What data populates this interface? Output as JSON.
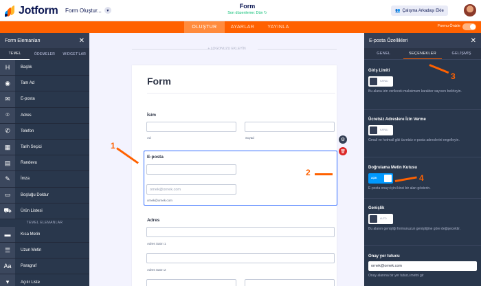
{
  "brand": {
    "name": "Jotform",
    "colors": {
      "orange": "#ff6100",
      "navy": "#0a1551",
      "panel": "#29374c",
      "blue": "#2e69ff"
    }
  },
  "topbar": {
    "form_name": "Form Oluştur...",
    "title": "Form",
    "status": "Son düzenleme: Dün",
    "team_button": "Çalışma Arkadaşı Ekle"
  },
  "nav": {
    "tabs": [
      "OLUŞTUR",
      "AYARLAR",
      "YAYINLA"
    ],
    "active": "OLUŞTUR",
    "preview_label": "Formu Önizle"
  },
  "left_panel": {
    "title": "Form Elemanları",
    "tabs": [
      "TEMEL",
      "ÖDEMELER",
      "WIDGET'LAR"
    ],
    "items": [
      {
        "icon": "heading-icon",
        "glyph": "H",
        "label": "Başlık"
      },
      {
        "icon": "user-icon",
        "glyph": "◉",
        "label": "Tam Ad"
      },
      {
        "icon": "mail-icon",
        "glyph": "✉",
        "label": "E-posta"
      },
      {
        "icon": "location-icon",
        "glyph": "⌾",
        "label": "Adres"
      },
      {
        "icon": "phone-icon",
        "glyph": "✆",
        "label": "Telefon"
      },
      {
        "icon": "calendar-icon",
        "glyph": "▦",
        "label": "Tarih Seçici"
      },
      {
        "icon": "appointment-icon",
        "glyph": "▤",
        "label": "Randevu"
      },
      {
        "icon": "signature-icon",
        "glyph": "✎",
        "label": "İmza"
      },
      {
        "icon": "fill-blank-icon",
        "glyph": "▭",
        "label": "Boşluğu Doldur"
      },
      {
        "icon": "cart-icon",
        "glyph": "⛟",
        "label": "Ürün Listesi"
      }
    ],
    "section_label": "TEMEL ELEMANLAR",
    "items2": [
      {
        "icon": "short-text-icon",
        "glyph": "▬",
        "label": "Kısa Metin"
      },
      {
        "icon": "long-text-icon",
        "glyph": "☰",
        "label": "Uzun Metin"
      },
      {
        "icon": "paragraph-icon",
        "glyph": "Aa",
        "label": "Paragraf"
      },
      {
        "icon": "dropdown-icon",
        "glyph": "▾",
        "label": "Açılır Liste"
      }
    ]
  },
  "canvas": {
    "logo_hint": "+ LOGONUZU EKLEYİN",
    "form_title": "Form",
    "name_label": "İsim",
    "first_sub": "Ad",
    "last_sub": "Soyad",
    "email_label": "E-posta",
    "email_placeholder": "ornek@ornek.com",
    "email_sub": "ornek@ornek.com",
    "address_label": "Adres",
    "addr1_sub": "Adres Satırı 1",
    "addr2_sub": "Adres Satırı 2"
  },
  "right_panel": {
    "title": "E-posta Özellikleri",
    "tabs": [
      "GENEL",
      "SEÇENEKLER",
      "GELİŞMİŞ"
    ],
    "active_tab": "SEÇENEKLER",
    "sections": {
      "limit": {
        "title": "Giriş Limiti",
        "toggle": "KAPALI",
        "desc": "Bu alana izin verilecek maksimum karakter sayısını belirleyin."
      },
      "free": {
        "title": "Ücretsiz Adreslere İzin Verme",
        "toggle": "KAPALI",
        "desc": "Gmail ve hotmail gibi ücretsiz e-posta adreslerini engelleyin."
      },
      "confirm": {
        "title": "Doğrulama Metin Kutusu",
        "toggle": "AÇIK",
        "desc": "E-posta onayı için ikinci bir alan gösterin."
      },
      "width": {
        "title": "Genişlik",
        "toggle": "AUTO",
        "desc": "Bu alanın genişliği formunuzun genişliğine göre değişecektir."
      },
      "placeholder": {
        "title": "Onay yer tutucu",
        "value": "ornek@ornek.com",
        "desc": "Onay alanına bir yer tutucu metni gir"
      }
    }
  },
  "annotations": [
    "1",
    "2",
    "3",
    "4"
  ]
}
